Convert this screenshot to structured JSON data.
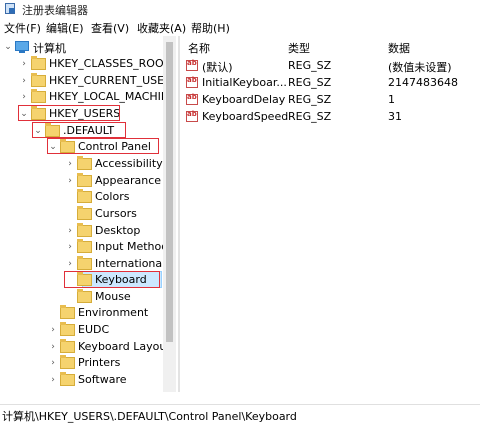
{
  "window": {
    "title": "注册表编辑器"
  },
  "menu": [
    "文件(F)",
    "编辑(E)",
    "查看(V)",
    "收藏夹(A)",
    "帮助(H)"
  ],
  "tree": {
    "root": "计算机",
    "nodes": [
      {
        "label": "HKEY_CLASSES_ROOT",
        "arrow": "›"
      },
      {
        "label": "HKEY_CURRENT_USER",
        "arrow": "›"
      },
      {
        "label": "HKEY_LOCAL_MACHINE",
        "arrow": "›"
      },
      {
        "label": "HKEY_USERS",
        "arrow": "⌄"
      },
      {
        "label": ".DEFAULT",
        "arrow": "⌄"
      },
      {
        "label": "Control Panel",
        "arrow": "⌄"
      },
      {
        "label": "Accessibility",
        "arrow": "›"
      },
      {
        "label": "Appearance",
        "arrow": "›"
      },
      {
        "label": "Colors",
        "arrow": ""
      },
      {
        "label": "Cursors",
        "arrow": ""
      },
      {
        "label": "Desktop",
        "arrow": "›"
      },
      {
        "label": "Input Method",
        "arrow": "›"
      },
      {
        "label": "International",
        "arrow": "›"
      },
      {
        "label": "Keyboard",
        "arrow": ""
      },
      {
        "label": "Mouse",
        "arrow": ""
      },
      {
        "label": "Environment",
        "arrow": ""
      },
      {
        "label": "EUDC",
        "arrow": "›"
      },
      {
        "label": "Keyboard Layout",
        "arrow": "›"
      },
      {
        "label": "Printers",
        "arrow": "›"
      },
      {
        "label": "Software",
        "arrow": "›"
      }
    ]
  },
  "list": {
    "columns": [
      "名称",
      "类型",
      "数据"
    ],
    "rows": [
      {
        "name": "(默认)",
        "type": "REG_SZ",
        "data": "(数值未设置)"
      },
      {
        "name": "InitialKeyboar...",
        "type": "REG_SZ",
        "data": "2147483648"
      },
      {
        "name": "KeyboardDelay",
        "type": "REG_SZ",
        "data": "1"
      },
      {
        "name": "KeyboardSpeed",
        "type": "REG_SZ",
        "data": "31"
      }
    ]
  },
  "status": {
    "path": "计算机\\HKEY_USERS\\.DEFAULT\\Control Panel\\Keyboard"
  },
  "colors": {
    "highlight_box": "#e0303a",
    "selection": "#cce8ff"
  }
}
